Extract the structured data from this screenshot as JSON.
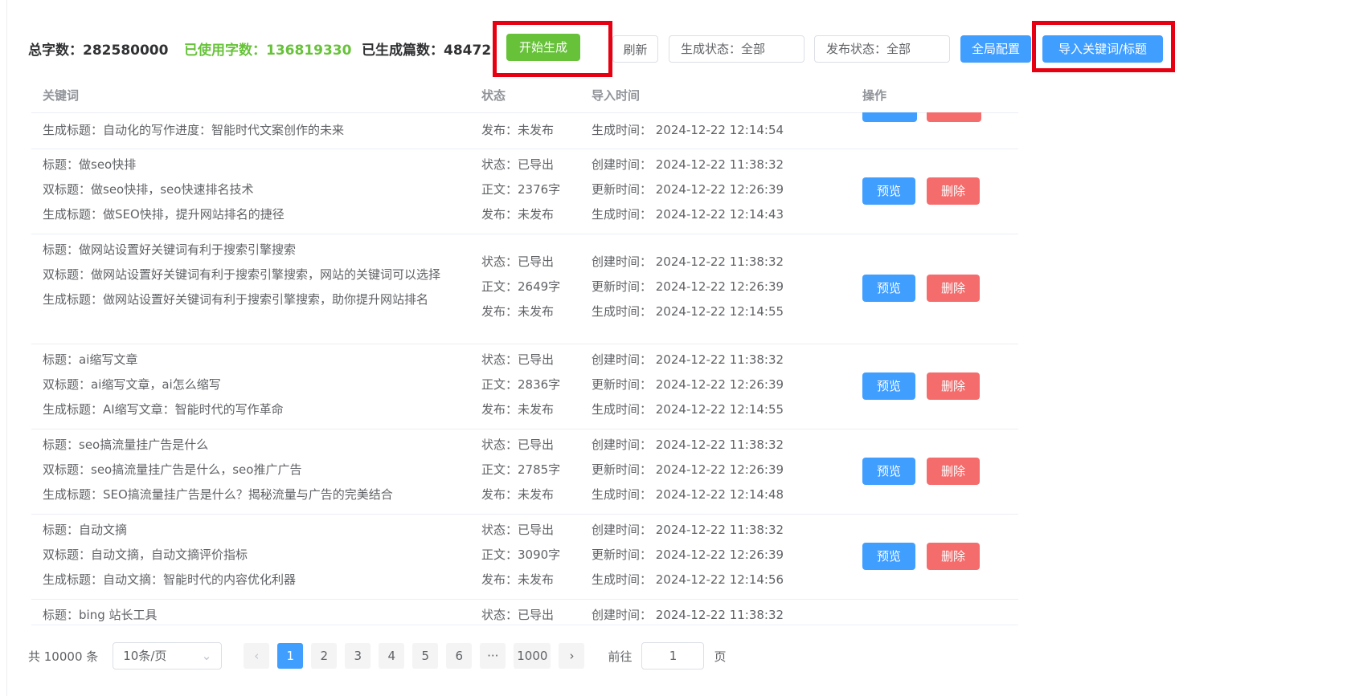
{
  "toolbar": {
    "total_words": "总字数：282580000",
    "used_words": "已使用字数：136819330",
    "generated_count": "已生成篇数：48472",
    "start_generate": "开始生成",
    "refresh": "刷新",
    "gen_status": "生成状态：全部",
    "pub_status": "发布状态：全部",
    "global_config": "全局配置",
    "import_keywords": "导入关键词/标题"
  },
  "table": {
    "headers": {
      "keyword": "关键词",
      "status": "状态",
      "import_time": "导入时间",
      "actions": "操作"
    },
    "preview_label": "预览",
    "delete_label": "删除",
    "partial_top": {
      "gen_title": "生成标题：自动化的写作进度：智能时代文案创作的未来",
      "publish": "发布：未发布",
      "gen_time": "生成时间：  2024-12-22 12:14:54"
    },
    "rows": [
      {
        "title": "标题：做seo快排",
        "dual_title": "双标题：做seo快排，seo快速排名技术",
        "gen_title": "生成标题：做SEO快排，提升网站排名的捷径",
        "state": "状态：已导出",
        "body": "正文：2376字",
        "publish": "发布：未发布",
        "created": "创建时间：  2024-12-22 11:38:32",
        "updated": "更新时间：  2024-12-22 12:26:39",
        "generated": "生成时间：  2024-12-22 12:14:43"
      },
      {
        "title": "标题：做网站设置好关键词有利于搜索引擎搜索",
        "dual_title": "双标题：做网站设置好关键词有利于搜索引擎搜索，网站的关键词可以选择",
        "gen_title": "生成标题：做网站设置好关键词有利于搜索引擎搜索，助你提升网站排名",
        "state": "状态：已导出",
        "body": "正文：2649字",
        "publish": "发布：未发布",
        "created": "创建时间：  2024-12-22 11:38:32",
        "updated": "更新时间：  2024-12-22 12:26:39",
        "generated": "生成时间：  2024-12-22 12:14:55"
      },
      {
        "title": "标题：ai缩写文章",
        "dual_title": "双标题：ai缩写文章，ai怎么缩写",
        "gen_title": "生成标题：AI缩写文章：智能时代的写作革命",
        "state": "状态：已导出",
        "body": "正文：2836字",
        "publish": "发布：未发布",
        "created": "创建时间：  2024-12-22 11:38:32",
        "updated": "更新时间：  2024-12-22 12:26:39",
        "generated": "生成时间：  2024-12-22 12:14:55"
      },
      {
        "title": "标题：seo搞流量挂广告是什么",
        "dual_title": "双标题：seo搞流量挂广告是什么，seo推广广告",
        "gen_title": "生成标题：SEO搞流量挂广告是什么？揭秘流量与广告的完美结合",
        "state": "状态：已导出",
        "body": "正文：2785字",
        "publish": "发布：未发布",
        "created": "创建时间：  2024-12-22 11:38:32",
        "updated": "更新时间：  2024-12-22 12:26:39",
        "generated": "生成时间：  2024-12-22 12:14:48"
      },
      {
        "title": "标题：自动文摘",
        "dual_title": "双标题：自动文摘，自动文摘评价指标",
        "gen_title": "生成标题：自动文摘：智能时代的内容优化利器",
        "state": "状态：已导出",
        "body": "正文：3090字",
        "publish": "发布：未发布",
        "created": "创建时间：  2024-12-22 11:38:32",
        "updated": "更新时间：  2024-12-22 12:26:39",
        "generated": "生成时间：  2024-12-22 12:14:56"
      },
      {
        "title": "标题：bing 站长工具",
        "state": "状态：已导出",
        "created": "创建时间：  2024-12-22 11:38:32"
      }
    ]
  },
  "pagination": {
    "total": "共 10000 条",
    "page_size": "10条/页",
    "prev": "‹",
    "pages": [
      "1",
      "2",
      "3",
      "4",
      "5",
      "6",
      "···",
      "1000"
    ],
    "next": "›",
    "goto_label": "前往",
    "goto_value": "1",
    "page_suffix": "页"
  },
  "colors": {
    "accent": "#409eff",
    "success": "#67c23a",
    "danger": "#f56c6c",
    "highlight": "#e60012"
  }
}
